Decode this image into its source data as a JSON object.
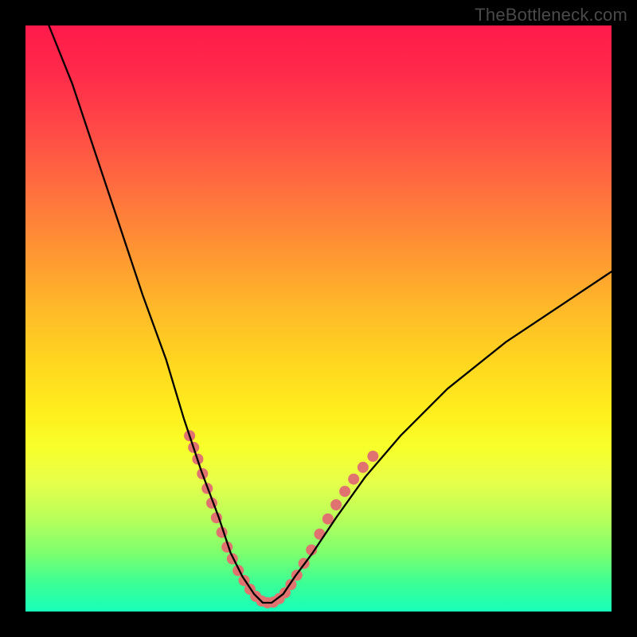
{
  "attribution": "TheBottleneck.com",
  "chart_data": {
    "type": "line",
    "title": "",
    "xlabel": "",
    "ylabel": "",
    "xlim": [
      0,
      100
    ],
    "ylim": [
      0,
      100
    ],
    "series": [
      {
        "name": "bottleneck-curve",
        "x": [
          4,
          8,
          12,
          16,
          20,
          24,
          27,
          30,
          33,
          35,
          37,
          39,
          40.5,
          42,
          44,
          46,
          49,
          53,
          58,
          64,
          72,
          82,
          94,
          100
        ],
        "y": [
          100,
          90,
          78,
          66,
          54,
          43,
          33,
          24,
          16,
          10,
          6,
          3,
          1.5,
          1.5,
          3,
          6,
          10,
          16,
          23,
          30,
          38,
          46,
          54,
          58
        ],
        "stroke": "#000000",
        "stroke_width": 2.3
      }
    ],
    "markers": {
      "name": "highlighted-range-dots",
      "color": "#e0726f",
      "radius": 7,
      "points": [
        {
          "x": 28.0,
          "y": 30.0
        },
        {
          "x": 28.7,
          "y": 28.0
        },
        {
          "x": 29.4,
          "y": 26.0
        },
        {
          "x": 30.2,
          "y": 23.5
        },
        {
          "x": 31.0,
          "y": 21.0
        },
        {
          "x": 31.8,
          "y": 18.5
        },
        {
          "x": 32.6,
          "y": 16.0
        },
        {
          "x": 33.5,
          "y": 13.5
        },
        {
          "x": 34.4,
          "y": 11.0
        },
        {
          "x": 35.3,
          "y": 9.0
        },
        {
          "x": 36.3,
          "y": 7.0
        },
        {
          "x": 37.3,
          "y": 5.3
        },
        {
          "x": 38.3,
          "y": 3.8
        },
        {
          "x": 39.3,
          "y": 2.6
        },
        {
          "x": 40.3,
          "y": 1.8
        },
        {
          "x": 41.3,
          "y": 1.5
        },
        {
          "x": 42.3,
          "y": 1.6
        },
        {
          "x": 43.3,
          "y": 2.2
        },
        {
          "x": 44.3,
          "y": 3.2
        },
        {
          "x": 45.3,
          "y": 4.6
        },
        {
          "x": 46.3,
          "y": 6.2
        },
        {
          "x": 47.5,
          "y": 8.2
        },
        {
          "x": 48.8,
          "y": 10.5
        },
        {
          "x": 50.2,
          "y": 13.2
        },
        {
          "x": 51.6,
          "y": 15.8
        },
        {
          "x": 53.0,
          "y": 18.2
        },
        {
          "x": 54.5,
          "y": 20.5
        },
        {
          "x": 56.0,
          "y": 22.6
        },
        {
          "x": 57.6,
          "y": 24.6
        },
        {
          "x": 59.3,
          "y": 26.5
        }
      ]
    }
  }
}
